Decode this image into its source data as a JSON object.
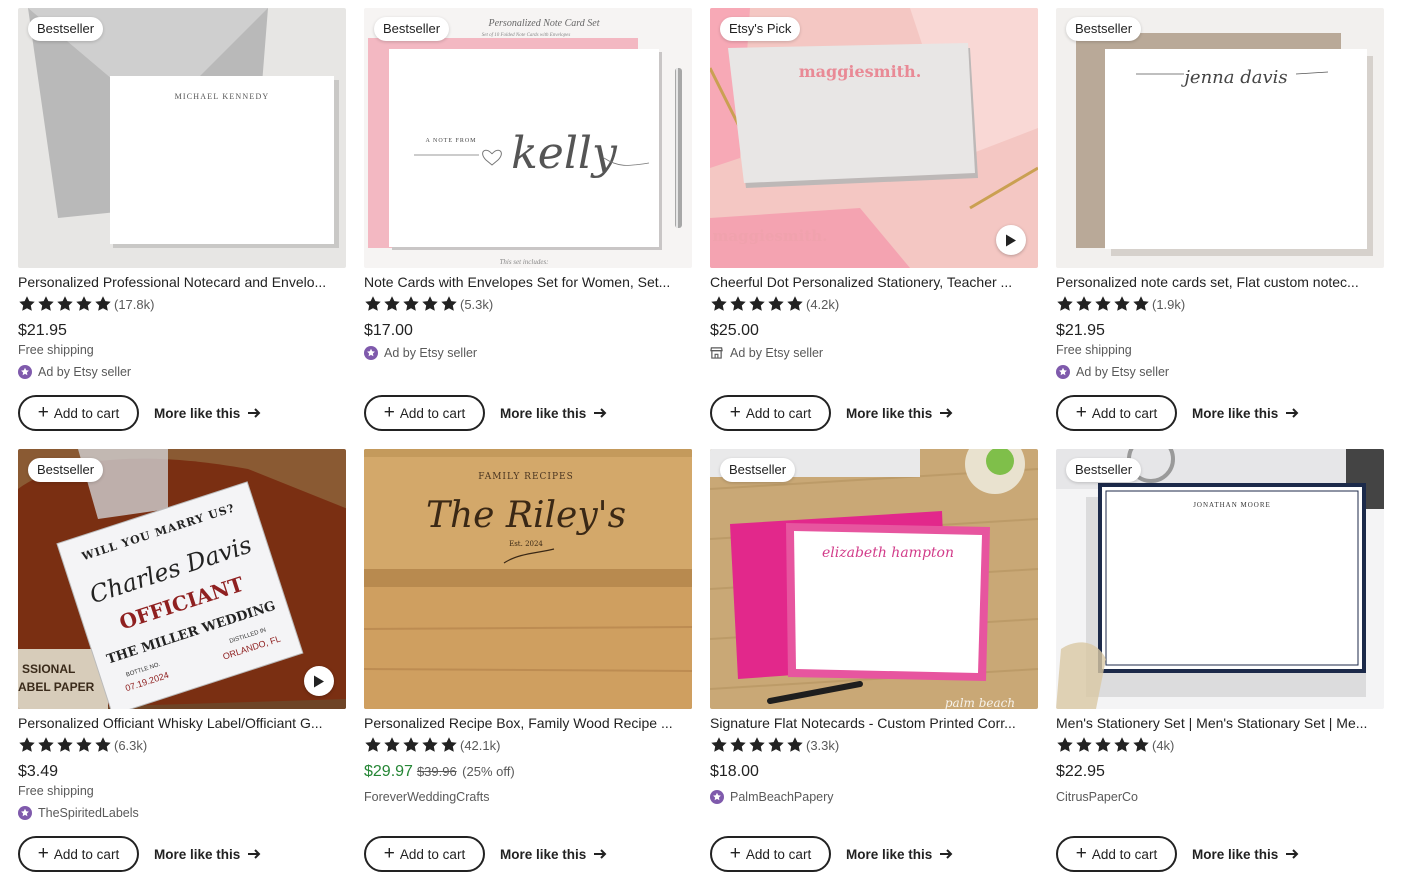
{
  "colors": {
    "star": "#222222",
    "seller_badge": "#7f5aac",
    "sale_price": "#258635",
    "button_border": "#222222"
  },
  "labels": {
    "add_to_cart": "Add to cart",
    "more_like_this": "More like this"
  },
  "listings": [
    {
      "badge": "Bestseller",
      "title": "Personalized Professional Notecard and Envelo...",
      "reviews": "(17.8k)",
      "price": "$21.95",
      "sale_price": null,
      "original_price": null,
      "discount": null,
      "shipping": "Free shipping",
      "seller": "Ad by Etsy seller",
      "seller_icon": "star-badge-icon",
      "has_video": false
    },
    {
      "badge": "Bestseller",
      "title": "Note Cards with Envelopes Set for Women, Set...",
      "reviews": "(5.3k)",
      "price": "$17.00",
      "sale_price": null,
      "original_price": null,
      "discount": null,
      "shipping": "",
      "seller": "Ad by Etsy seller",
      "seller_icon": "star-badge-icon",
      "has_video": false
    },
    {
      "badge": "Etsy's Pick",
      "title": "Cheerful Dot Personalized Stationery, Teacher ...",
      "reviews": "(4.2k)",
      "price": "$25.00",
      "sale_price": null,
      "original_price": null,
      "discount": null,
      "shipping": "",
      "seller": "Ad by Etsy seller",
      "seller_icon": "shop-icon",
      "has_video": true
    },
    {
      "badge": "Bestseller",
      "title": "Personalized note cards set, Flat custom notec...",
      "reviews": "(1.9k)",
      "price": "$21.95",
      "sale_price": null,
      "original_price": null,
      "discount": null,
      "shipping": "Free shipping",
      "seller": "Ad by Etsy seller",
      "seller_icon": "star-badge-icon",
      "has_video": false
    },
    {
      "badge": "Bestseller",
      "title": "Personalized Officiant Whisky Label/Officiant G...",
      "reviews": "(6.3k)",
      "price": "$3.49",
      "sale_price": null,
      "original_price": null,
      "discount": null,
      "shipping": "Free shipping",
      "seller": "TheSpiritedLabels",
      "seller_icon": "star-badge-icon",
      "has_video": true
    },
    {
      "badge": "",
      "title": "Personalized Recipe Box, Family Wood Recipe ...",
      "reviews": "(42.1k)",
      "price": "",
      "sale_price": "$29.97",
      "original_price": "$39.96",
      "discount": "(25% off)",
      "shipping": "",
      "seller": "ForeverWeddingCrafts",
      "seller_icon": "",
      "has_video": false
    },
    {
      "badge": "Bestseller",
      "title": "Signature Flat Notecards - Custom Printed Corr...",
      "reviews": "(3.3k)",
      "price": "$18.00",
      "sale_price": null,
      "original_price": null,
      "discount": null,
      "shipping": "",
      "seller": "PalmBeachPapery",
      "seller_icon": "star-badge-icon",
      "has_video": false
    },
    {
      "badge": "Bestseller",
      "title": "Men's Stationery Set | Men's Stationary Set | Me...",
      "reviews": "(4k)",
      "price": "$22.95",
      "sale_price": null,
      "original_price": null,
      "discount": null,
      "shipping": "",
      "seller": "CitrusPaperCo",
      "seller_icon": "",
      "has_video": false
    }
  ],
  "image_text": {
    "l0": {
      "name": "MICHAEL KENNEDY"
    },
    "l1": {
      "heading": "Personalized Note Card Set",
      "sub": "Set of 10 Folded Note Cards with Envelopes",
      "from": "A NOTE FROM",
      "name": "kelly",
      "footer": "This set includes:"
    },
    "l2": {
      "name": "maggiesmith."
    },
    "l3": {
      "name": "jenna davis"
    },
    "l4": {
      "top": "WILL YOU MARRY US?",
      "name": "Charles Davis",
      "role": "OFFICIANT",
      "event": "THE MILLER WEDDING",
      "bottle": "BOTTLE NO.",
      "date": "07.19.2024",
      "distilled": "DISTILLED IN",
      "city": "ORLANDO, FL",
      "side1": "SSIONAL",
      "side2": "ABEL PAPER"
    },
    "l5": {
      "arc": "FAMILY RECIPES",
      "name": "The Riley's",
      "est": "Est. 2024"
    },
    "l6": {
      "name": "elizabeth hampton",
      "corner": "palm beach"
    },
    "l7": {
      "name": "JONATHAN MOORE"
    }
  }
}
